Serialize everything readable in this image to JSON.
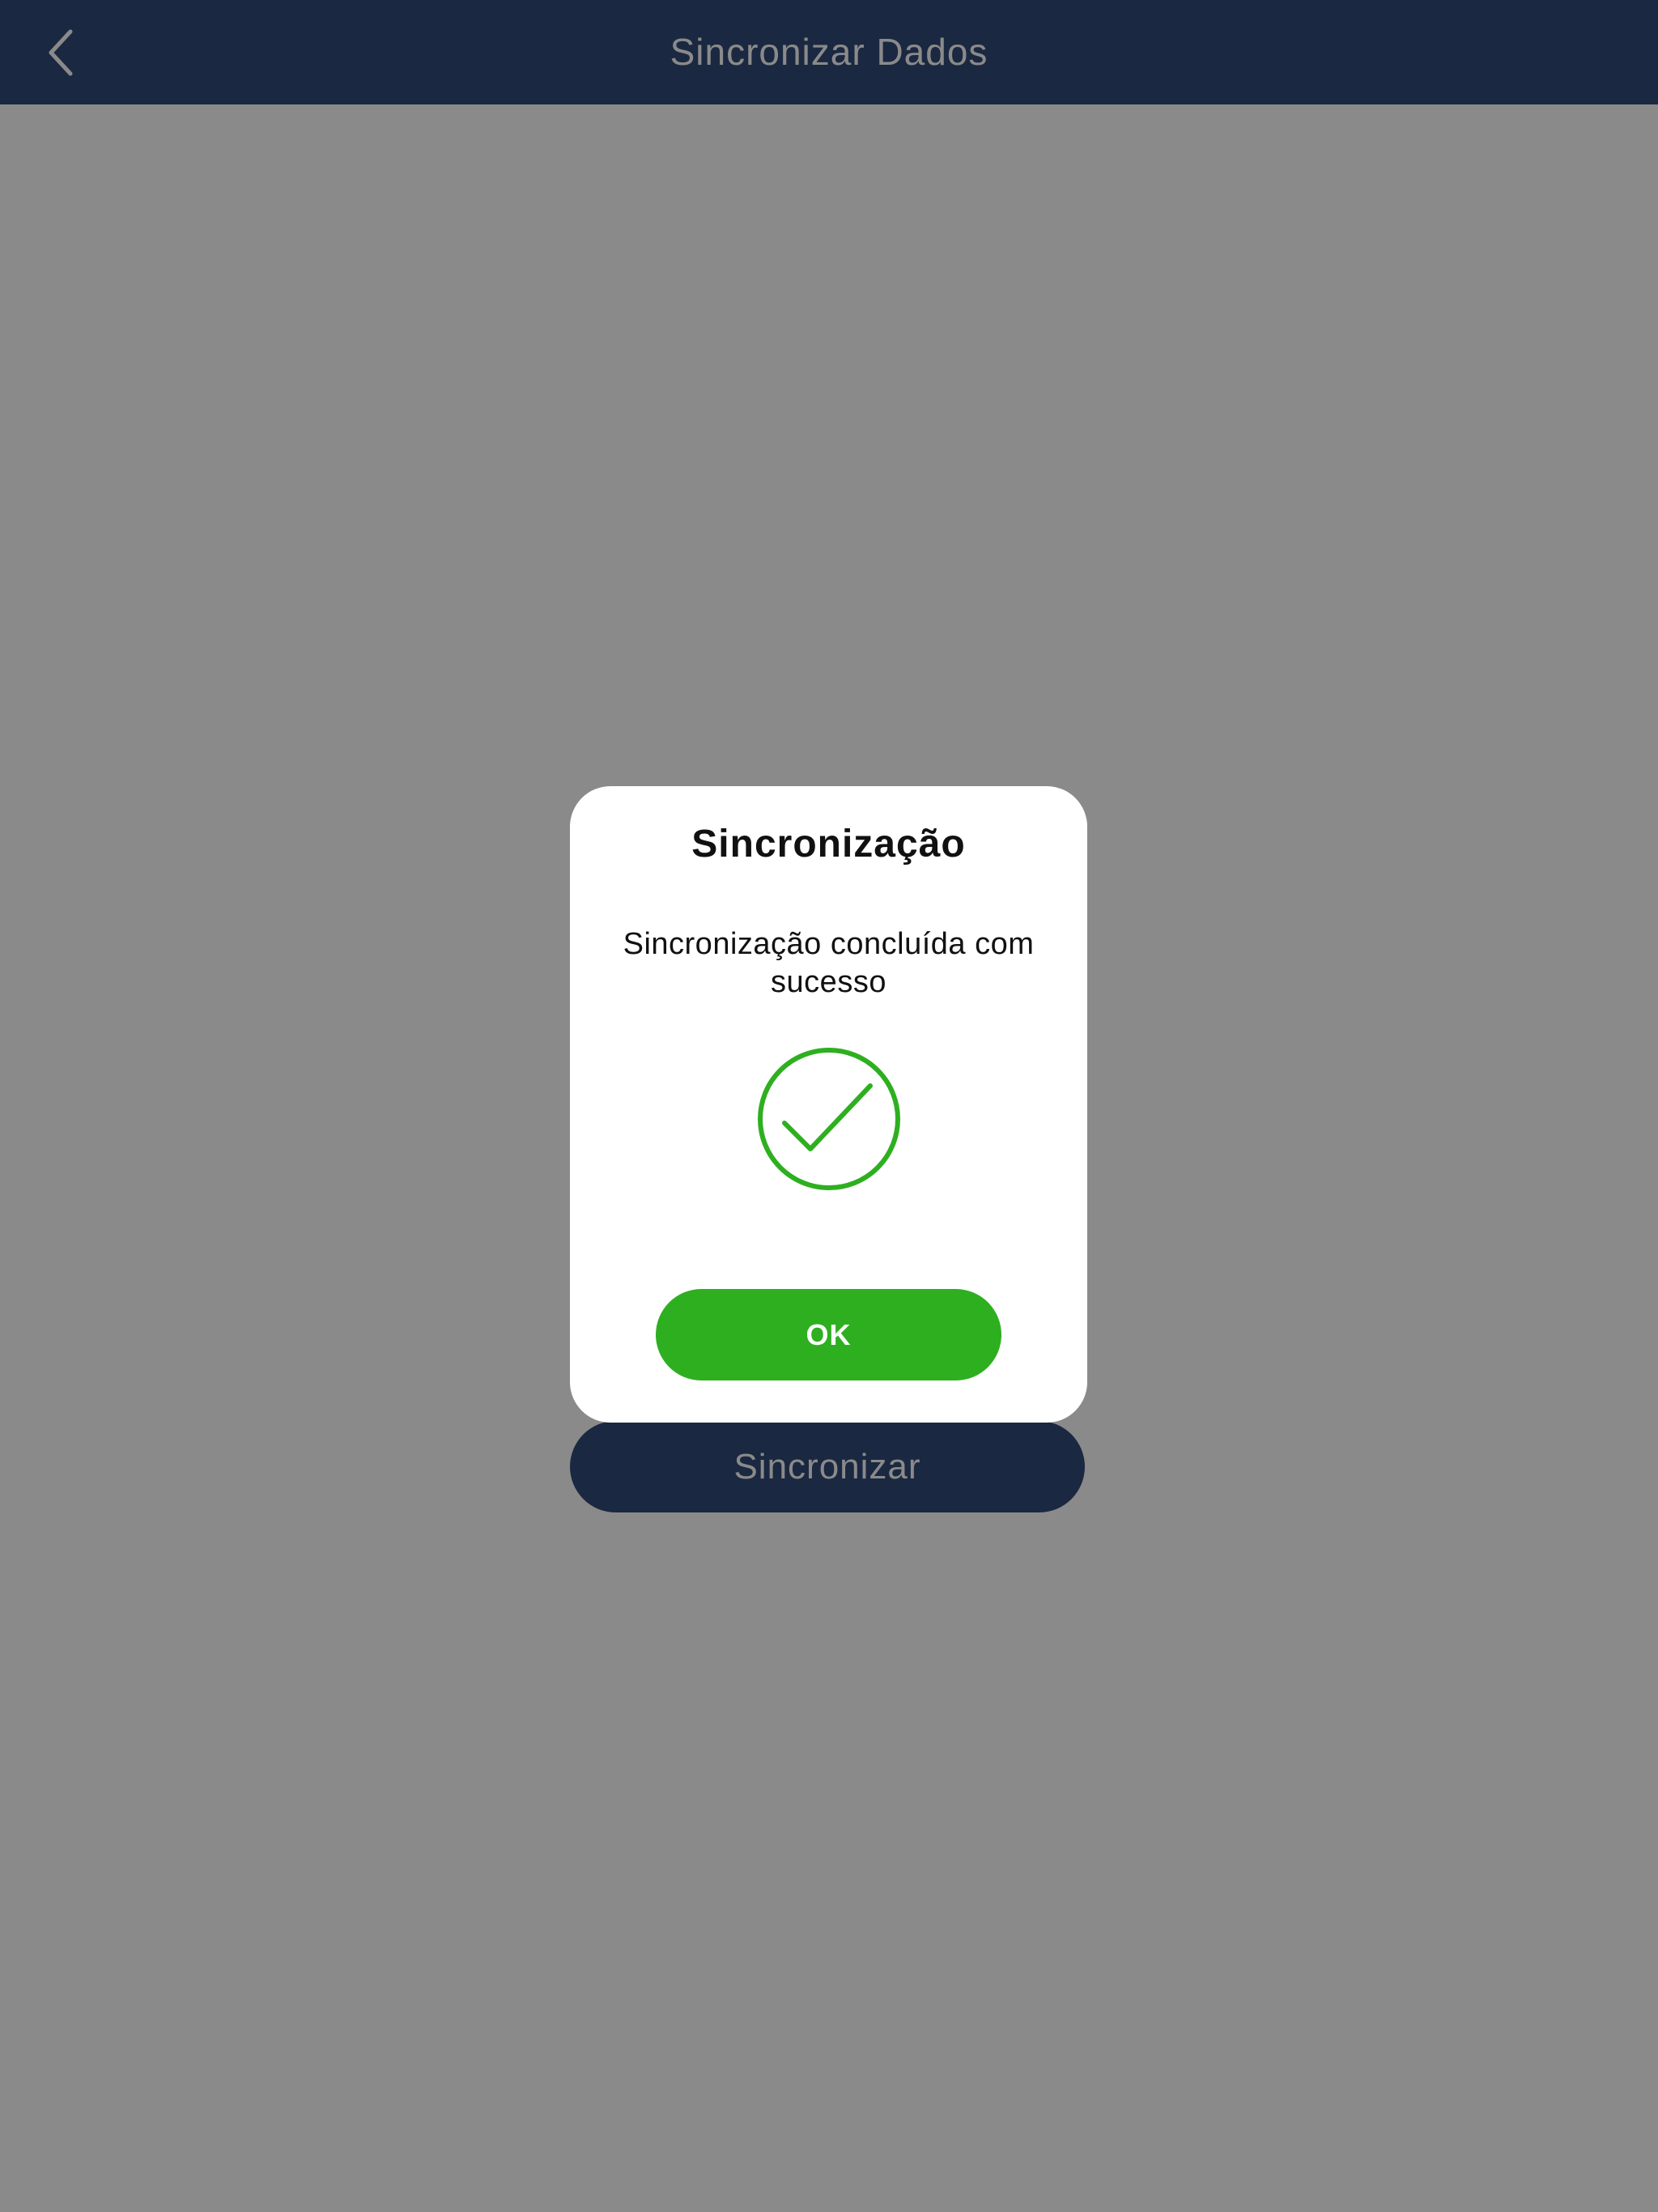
{
  "header": {
    "title": "Sincronizar Dados",
    "back_icon": "chevron-left-icon"
  },
  "main": {
    "sync_button_label": "Sincronizar"
  },
  "dialog": {
    "title": "Sincronização",
    "message": "Sincronização concluída com sucesso",
    "icon": "success-check-icon",
    "ok_label": "OK"
  },
  "colors": {
    "navbar": "#314a78",
    "success": "#2eaf20",
    "overlay": "rgba(0,0,0,0.46)"
  }
}
